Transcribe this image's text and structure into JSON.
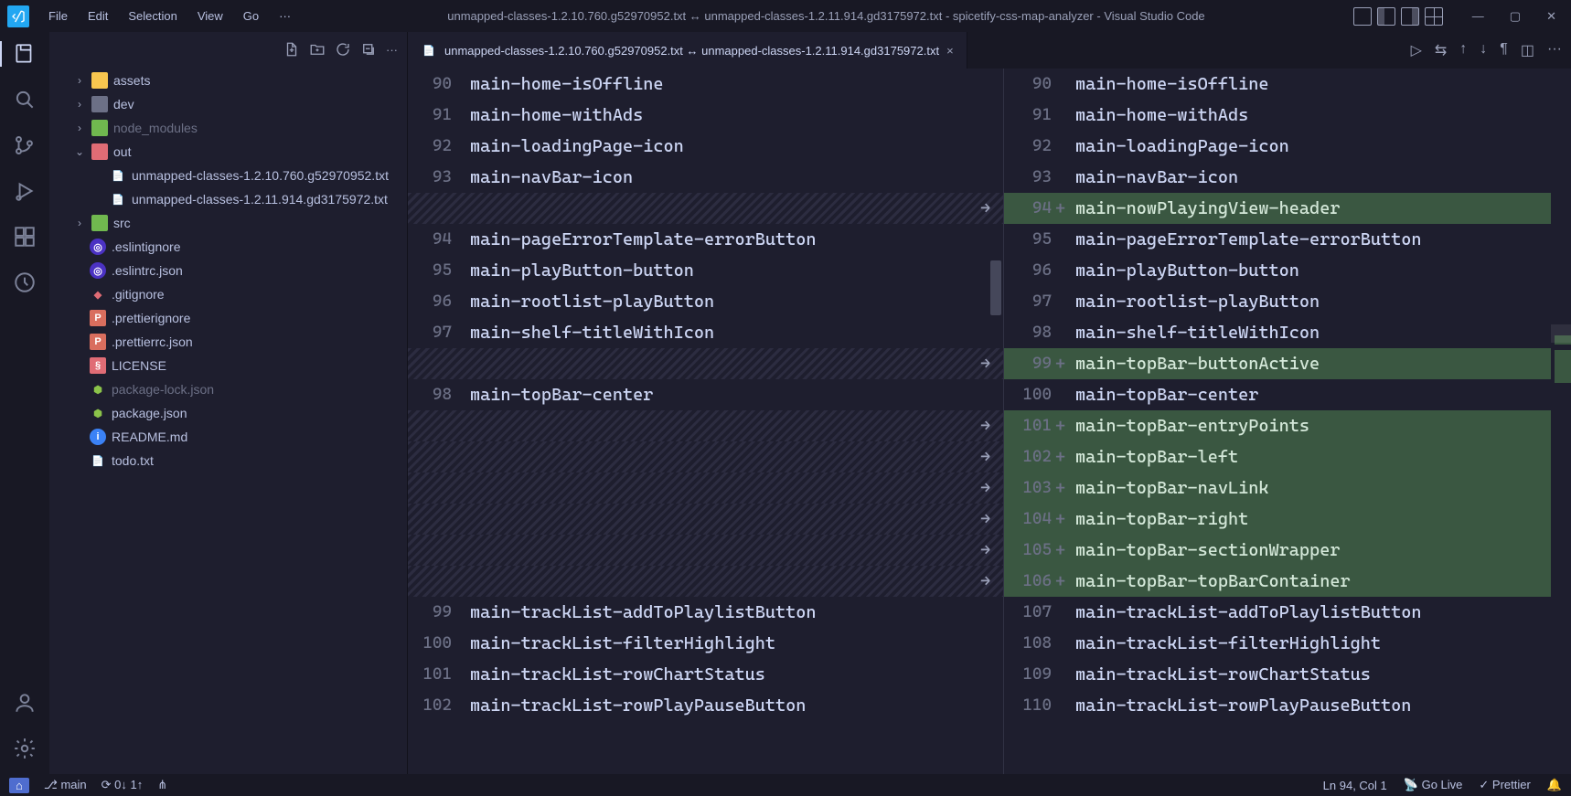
{
  "menu": {
    "file": "File",
    "edit": "Edit",
    "selection": "Selection",
    "view": "View",
    "go": "Go",
    "more": "···"
  },
  "title": "unmapped-classes-1.2.10.760.g52970952.txt ↔ unmapped-classes-1.2.11.914.gd3175972.txt - spicetify-css-map-analyzer - Visual Studio Code",
  "tab": {
    "label": "unmapped-classes-1.2.10.760.g52970952.txt ↔ unmapped-classes-1.2.11.914.gd3175972.txt",
    "close": "×"
  },
  "tree": {
    "assets": "assets",
    "dev": "dev",
    "node_modules": "node_modules",
    "out": "out",
    "file1": "unmapped-classes-1.2.10.760.g52970952.txt",
    "file2": "unmapped-classes-1.2.11.914.gd3175972.txt",
    "src": "src",
    "eslintignore": ".eslintignore",
    "eslintrc": ".eslintrc.json",
    "gitignore": ".gitignore",
    "prettierignore": ".prettierignore",
    "prettierrc": ".prettierrc.json",
    "license": "LICENSE",
    "pkglock": "package-lock.json",
    "pkg": "package.json",
    "readme": "README.md",
    "todo": "todo.txt"
  },
  "left_lines": [
    {
      "n": "90",
      "t": "main-home-isOffline"
    },
    {
      "n": "91",
      "t": "main-home-withAds"
    },
    {
      "n": "92",
      "t": "main-loadingPage-icon"
    },
    {
      "n": "93",
      "t": "main-navBar-icon"
    },
    {
      "n": "",
      "t": "",
      "hatch": true
    },
    {
      "n": "94",
      "t": "main-pageErrorTemplate-errorButton"
    },
    {
      "n": "95",
      "t": "main-playButton-button"
    },
    {
      "n": "96",
      "t": "main-rootlist-playButton"
    },
    {
      "n": "97",
      "t": "main-shelf-titleWithIcon"
    },
    {
      "n": "",
      "t": "",
      "hatch": true
    },
    {
      "n": "98",
      "t": "main-topBar-center"
    },
    {
      "n": "",
      "t": "",
      "hatch": true
    },
    {
      "n": "",
      "t": "",
      "hatch": true
    },
    {
      "n": "",
      "t": "",
      "hatch": true
    },
    {
      "n": "",
      "t": "",
      "hatch": true
    },
    {
      "n": "",
      "t": "",
      "hatch": true
    },
    {
      "n": "",
      "t": "",
      "hatch": true
    },
    {
      "n": "99",
      "t": "main-trackList-addToPlaylistButton"
    },
    {
      "n": "100",
      "t": "main-trackList-filterHighlight"
    },
    {
      "n": "101",
      "t": "main-trackList-rowChartStatus"
    },
    {
      "n": "102",
      "t": "main-trackList-rowPlayPauseButton"
    }
  ],
  "right_lines": [
    {
      "n": "90",
      "m": "",
      "t": "main-home-isOffline"
    },
    {
      "n": "91",
      "m": "",
      "t": "main-home-withAds"
    },
    {
      "n": "92",
      "m": "",
      "t": "main-loadingPage-icon"
    },
    {
      "n": "93",
      "m": "",
      "t": "main-navBar-icon"
    },
    {
      "n": "94",
      "m": "+",
      "t": "main-nowPlayingView-header",
      "added": true
    },
    {
      "n": "95",
      "m": "",
      "t": "main-pageErrorTemplate-errorButton"
    },
    {
      "n": "96",
      "m": "",
      "t": "main-playButton-button"
    },
    {
      "n": "97",
      "m": "",
      "t": "main-rootlist-playButton"
    },
    {
      "n": "98",
      "m": "",
      "t": "main-shelf-titleWithIcon"
    },
    {
      "n": "99",
      "m": "+",
      "t": "main-topBar-buttonActive",
      "added": true
    },
    {
      "n": "100",
      "m": "",
      "t": "main-topBar-center"
    },
    {
      "n": "101",
      "m": "+",
      "t": "main-topBar-entryPoints",
      "added": true
    },
    {
      "n": "102",
      "m": "+",
      "t": "main-topBar-left",
      "added": true
    },
    {
      "n": "103",
      "m": "+",
      "t": "main-topBar-navLink",
      "added": true
    },
    {
      "n": "104",
      "m": "+",
      "t": "main-topBar-right",
      "added": true
    },
    {
      "n": "105",
      "m": "+",
      "t": "main-topBar-sectionWrapper",
      "added": true
    },
    {
      "n": "106",
      "m": "+",
      "t": "main-topBar-topBarContainer",
      "added": true
    },
    {
      "n": "107",
      "m": "",
      "t": "main-trackList-addToPlaylistButton"
    },
    {
      "n": "108",
      "m": "",
      "t": "main-trackList-filterHighlight"
    },
    {
      "n": "109",
      "m": "",
      "t": "main-trackList-rowChartStatus"
    },
    {
      "n": "110",
      "m": "",
      "t": "main-trackList-rowPlayPauseButton"
    }
  ],
  "status": {
    "branch": "main",
    "sync": "0↓ 1↑",
    "cursor": "Ln 94, Col 1",
    "golive": "Go Live",
    "prettier": "Prettier"
  }
}
